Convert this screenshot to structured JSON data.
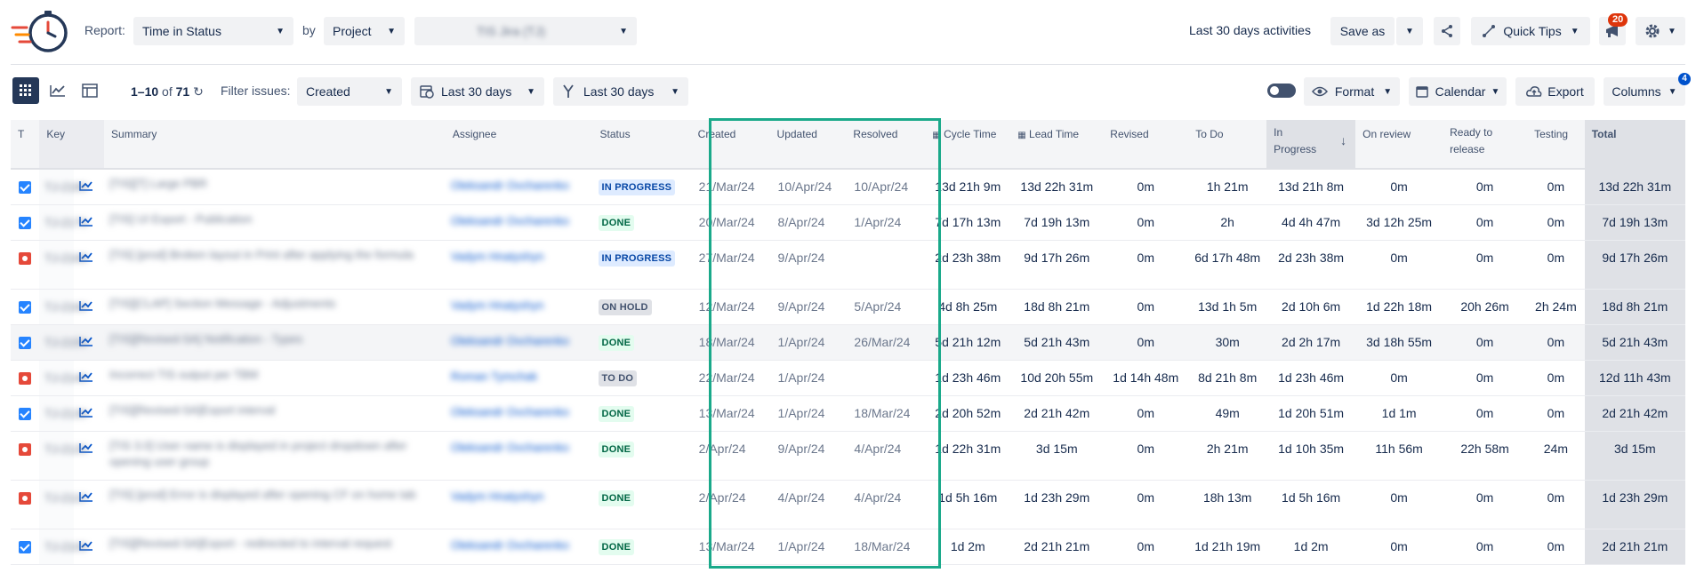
{
  "header": {
    "report_label": "Report:",
    "report_value": "Time in Status",
    "by_label": "by",
    "by_value": "Project",
    "project_value": "TIS Jira (TJ)",
    "last_activities": "Last 30 days activities",
    "save_as": "Save as",
    "quick_tips": "Quick Tips",
    "notifications_count": "20"
  },
  "toolbar": {
    "range": "1–10",
    "of": "of",
    "total": "71",
    "filter_label": "Filter issues:",
    "filter_field": "Created",
    "date_range_1": "Last 30 days",
    "date_range_2": "Last 30 days",
    "format": "Format",
    "calendar": "Calendar",
    "export": "Export",
    "columns": "Columns",
    "columns_badge": "4"
  },
  "columns": {
    "t": "T",
    "key": "Key",
    "summary": "Summary",
    "assignee": "Assignee",
    "status": "Status",
    "created": "Created",
    "updated": "Updated",
    "resolved": "Resolved",
    "cycle_time": "Cycle Time",
    "lead_time": "Lead Time",
    "revised": "Revised",
    "to_do": "To Do",
    "in_progress": "In Progress",
    "on_review": "On review",
    "ready_to_release": "Ready to release",
    "testing": "Testing",
    "total": "Total"
  },
  "rows": [
    {
      "type": "task",
      "key": "TJ-2180",
      "summary": "[TIS][T] Large PBR",
      "assignee": "Oleksandr Ovcharenko",
      "status": "IN PROGRESS",
      "status_class": "inprogress",
      "created": "21/Mar/24",
      "updated": "10/Apr/24",
      "resolved": "10/Apr/24",
      "cycle": "13d 21h 9m",
      "lead": "13d 22h 31m",
      "revised": "0m",
      "todo": "1h 21m",
      "inprog": "13d 21h 8m",
      "review": "0m",
      "ready": "0m",
      "testing": "0m",
      "total": "13d 22h 31m"
    },
    {
      "type": "task",
      "key": "TJ-2170",
      "summary": "[TIS] UI Export - Publication",
      "assignee": "Oleksandr Ovcharenko",
      "status": "DONE",
      "status_class": "done",
      "created": "20/Mar/24",
      "updated": "8/Apr/24",
      "resolved": "1/Apr/24",
      "cycle": "7d 17h 13m",
      "lead": "7d 19h 13m",
      "revised": "0m",
      "todo": "2h",
      "inprog": "4d 4h 47m",
      "review": "3d 12h 25m",
      "ready": "0m",
      "testing": "0m",
      "total": "7d 19h 13m"
    },
    {
      "type": "bug",
      "key": "TJ-2168",
      "summary": "[TIS] [prod] Broken layout in Print after applying the formula",
      "assignee": "Vadym Hnatyshyn",
      "status": "IN PROGRESS",
      "status_class": "inprogress",
      "created": "27/Mar/24",
      "updated": "9/Apr/24",
      "resolved": "",
      "cycle": "2d 23h 38m",
      "lead": "9d 17h 26m",
      "revised": "0m",
      "todo": "6d 17h 48m",
      "inprog": "2d 23h 38m",
      "review": "0m",
      "ready": "0m",
      "testing": "0m",
      "total": "9d 17h 26m"
    },
    {
      "type": "task",
      "key": "TJ-2160",
      "summary": "[TIS][CLAP] Section Message - Adjustments",
      "assignee": "Vadym Hnatyshyn",
      "status": "ON HOLD",
      "status_class": "onhold",
      "created": "12/Mar/24",
      "updated": "9/Apr/24",
      "resolved": "5/Apr/24",
      "cycle": "4d 8h 25m",
      "lead": "18d 8h 21m",
      "revised": "0m",
      "todo": "13d 1h 5m",
      "inprog": "2d 10h 6m",
      "review": "1d 22h 18m",
      "ready": "20h 26m",
      "testing": "2h 24m",
      "total": "18d 8h 21m"
    },
    {
      "type": "task",
      "key": "TJ-2150",
      "summary": "[TIS][Revised-SA] Notification - Types",
      "assignee": "Oleksandr Ovcharenko",
      "status": "DONE",
      "status_class": "done",
      "created": "18/Mar/24",
      "updated": "1/Apr/24",
      "resolved": "26/Mar/24",
      "cycle": "5d 21h 12m",
      "lead": "5d 21h 43m",
      "revised": "0m",
      "todo": "30m",
      "inprog": "2d 2h 17m",
      "review": "3d 18h 55m",
      "ready": "0m",
      "testing": "0m",
      "total": "5d 21h 43m"
    },
    {
      "type": "bug",
      "key": "TJ-2140",
      "summary": "Incorrect TIS output per TBM",
      "assignee": "Roman Tymchak",
      "status": "TO DO",
      "status_class": "todo",
      "created": "22/Mar/24",
      "updated": "1/Apr/24",
      "resolved": "",
      "cycle": "1d 23h 46m",
      "lead": "10d 20h 55m",
      "revised": "1d 14h 48m",
      "todo": "8d 21h 8m",
      "inprog": "1d 23h 46m",
      "review": "0m",
      "ready": "0m",
      "testing": "0m",
      "total": "12d 11h 43m"
    },
    {
      "type": "task",
      "key": "TJ-2130",
      "summary": "[TIS][Revised-SA]Export interval",
      "assignee": "Oleksandr Ovcharenko",
      "status": "DONE",
      "status_class": "done",
      "created": "13/Mar/24",
      "updated": "1/Apr/24",
      "resolved": "18/Mar/24",
      "cycle": "2d 20h 52m",
      "lead": "2d 21h 42m",
      "revised": "0m",
      "todo": "49m",
      "inprog": "1d 20h 51m",
      "review": "1d 1m",
      "ready": "0m",
      "testing": "0m",
      "total": "2d 21h 42m"
    },
    {
      "type": "bug",
      "key": "TJ-2120",
      "summary": "[TIS 3.0] User name is displayed in project dropdown after opening user group",
      "assignee": "Oleksandr Ovcharenko",
      "status": "DONE",
      "status_class": "done",
      "created": "2/Apr/24",
      "updated": "9/Apr/24",
      "resolved": "4/Apr/24",
      "cycle": "1d 22h 31m",
      "lead": "3d 15m",
      "revised": "0m",
      "todo": "2h 21m",
      "inprog": "1d 10h 35m",
      "review": "11h 56m",
      "ready": "22h 58m",
      "testing": "24m",
      "total": "3d 15m"
    },
    {
      "type": "bug",
      "key": "TJ-2110",
      "summary": "[TIS] [prod] Error is displayed after opening CF on home tab",
      "assignee": "Vadym Hnatyshyn",
      "status": "DONE",
      "status_class": "done",
      "created": "2/Apr/24",
      "updated": "4/Apr/24",
      "resolved": "4/Apr/24",
      "cycle": "1d 5h 16m",
      "lead": "1d 23h 29m",
      "revised": "0m",
      "todo": "18h 13m",
      "inprog": "1d 5h 16m",
      "review": "0m",
      "ready": "0m",
      "testing": "0m",
      "total": "1d 23h 29m"
    },
    {
      "type": "task",
      "key": "TJ-2100",
      "summary": "[TIS][Revised-SA]Export - redirected to interval request",
      "assignee": "Oleksandr Ovcharenko",
      "status": "DONE",
      "status_class": "done",
      "created": "13/Mar/24",
      "updated": "1/Apr/24",
      "resolved": "18/Mar/24",
      "cycle": "1d 2m",
      "lead": "2d 21h 21m",
      "revised": "0m",
      "todo": "1d 21h 19m",
      "inprog": "1d 2m",
      "review": "0m",
      "ready": "0m",
      "testing": "0m",
      "total": "2d 21h 21m"
    }
  ]
}
